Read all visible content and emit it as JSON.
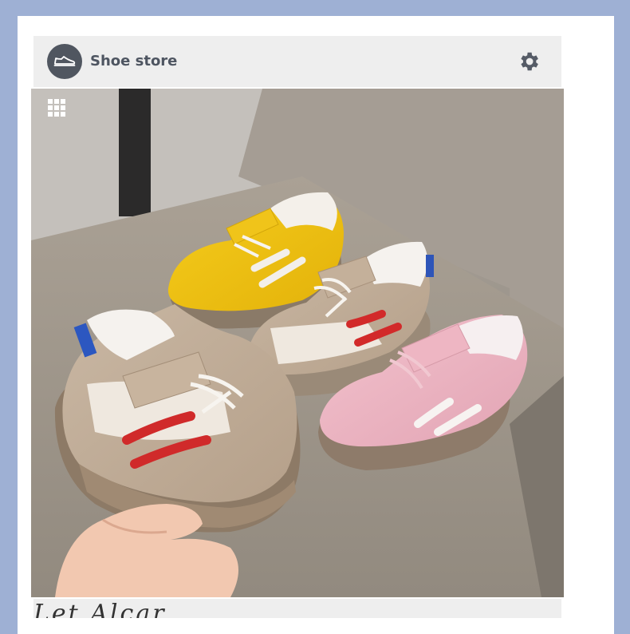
{
  "app": {
    "title": "Shoe store",
    "logo_icon": "sneaker-icon",
    "settings_icon": "gear-icon"
  },
  "gallery": {
    "grid_icon": "grid-icon",
    "image_alt": "Four children's sneakers in yellow, beige with red stripes, pink, and beige with blue heel",
    "colors": {
      "background": "#9eb0d4",
      "header": "#eeeeee",
      "title": "#4e5561"
    }
  },
  "footer": {
    "partial_text": "Let Alcar"
  }
}
